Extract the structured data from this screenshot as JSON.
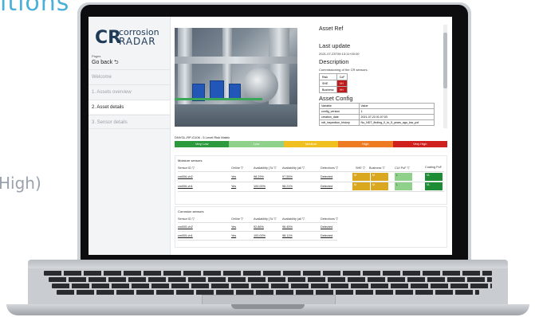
{
  "background": {
    "title_fragment": "itions",
    "side_fragment": "High)"
  },
  "app": {
    "logo": {
      "mark": "CR",
      "line1": "corrosion",
      "line2": "RADAR"
    },
    "pages_label": "Pages",
    "go_back": "Go back ⮌",
    "nav": [
      "Welcome",
      "1. Assets overview",
      "2. Asset details",
      "3. Sensor details"
    ],
    "active_nav_index": 2
  },
  "asset_panel": {
    "title": "Asset Ref",
    "last_update_heading": "Last update",
    "last_update_value": "2021-07-23T09:13:11+00:00",
    "description_heading": "Description",
    "description_value": "Commissioning of the CR sensors.",
    "risk_table": {
      "headers": [
        "Risk",
        "CoF"
      ],
      "rows": [
        [
          "SHE",
          "VH"
        ],
        [
          "Business",
          "VH"
        ]
      ]
    },
    "config_heading": "Asset Config",
    "config_table": {
      "headers": [
        "Variable",
        "Value"
      ],
      "rows": [
        [
          "config_version",
          "1"
        ],
        [
          "creation_date",
          "2021-07-23 01:07:03"
        ],
        [
          "ndt_inspection_history",
          "No_NDT_finding_0_to_5_years_ago_low_pof"
        ]
      ]
    }
  },
  "risk_matrix": {
    "title": "DNVGL-RP-G106 - 5 Level Risk Matrix",
    "levels": [
      {
        "label": "Very Low",
        "color": "#2e9a3e"
      },
      {
        "label": "Low",
        "color": "#8fd08a"
      },
      {
        "label": "Medium",
        "color": "#f0c020"
      },
      {
        "label": "High",
        "color": "#ee7b22"
      },
      {
        "label": "Very High",
        "color": "#d0201d"
      }
    ]
  },
  "moisture": {
    "title": "Moisture sensors",
    "headers": [
      "Sensor ID ▽",
      "Online ▽",
      "Availability (7d ▽",
      "Availability (all ▽",
      "Detections ▽",
      "SHE ▽",
      "Business ▽",
      "CUI PoF ▽",
      "Coating PoF"
    ],
    "rows": [
      {
        "id": "cm006-ch2",
        "online": "Yes",
        "avail7": "98.29%",
        "availAll": "97.55%",
        "detections": "Detected",
        "she": "M",
        "business": "M",
        "cui": "L",
        "coating": "VL"
      },
      {
        "id": "cm006-ch1",
        "online": "Yes",
        "avail7": "100.00%",
        "availAll": "98.21%",
        "detections": "Detected",
        "she": "M",
        "business": "M",
        "cui": "L",
        "coating": "VL"
      }
    ]
  },
  "corrosion": {
    "title": "Corrosion sensors",
    "headers": [
      "Sensor ID ▽",
      "Online ▽",
      "Availability (7d ▽",
      "Availability (all ▽",
      "Detections ▽"
    ],
    "rows": [
      {
        "id": "cm005-ch2",
        "online": "Yes",
        "avail7": "92.86%",
        "availAll": "96.45%",
        "detections": "Detected"
      },
      {
        "id": "cm005-ch1",
        "online": "Yes",
        "avail7": "100.00%",
        "availAll": "98.11%",
        "detections": "Detected"
      }
    ]
  }
}
